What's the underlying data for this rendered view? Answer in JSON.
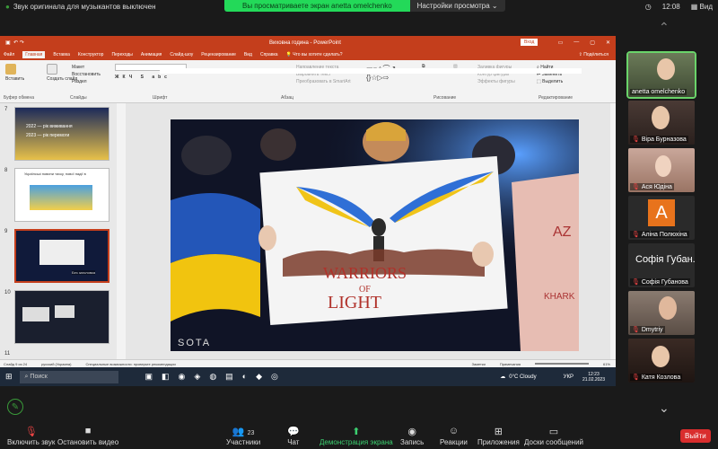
{
  "top": {
    "original_sound_warning": "Звук оригинала для музыкантов выключен",
    "share_banner": "Вы просматриваете экран anetta omelchenko",
    "view_settings": "Настройки просмотра",
    "time": "12:08",
    "view_label": "Вид"
  },
  "powerpoint": {
    "title": "Виховна година - PowerPoint",
    "signin_label": "Вход",
    "tabs": [
      "Файл",
      "Главная",
      "Вставка",
      "Конструктор",
      "Переходы",
      "Анимация",
      "Слайд-шоу",
      "Рецензирование",
      "Вид",
      "Справка"
    ],
    "active_tab": "Главная",
    "search_prompt": "Что вы хотите сделать?",
    "share_label": "Подёлиться",
    "ribbon": {
      "paste": "Вставить",
      "create_slide": "Создать слайд",
      "layout": "Макет",
      "restore": "Восстановить",
      "section": "Раздел",
      "text_direction": "Направление текста",
      "align_text": "Выровнять текст",
      "smartart": "Преобразовать в SmartArt",
      "arrange": "Упорядочить",
      "quick_styles": "Экспресс-стили",
      "shape_fill": "Заливка фигуры",
      "shape_outline": "Контур фигуры",
      "shape_effects": "Эффекты фигуры",
      "find": "Найти",
      "replace": "Заменить",
      "select": "Выделить",
      "groups": [
        "Буфер обмена",
        "Слайды",
        "Шрифт",
        "Абзац",
        "Рисование",
        "Редактирование"
      ]
    },
    "thumbnails": [
      {
        "num": "7",
        "caption_top": "2022 — рік виживання",
        "caption_bottom": "2023 — рік перемоги"
      },
      {
        "num": "8",
        "caption_top": "Українські новини тиску, нової надії в"
      },
      {
        "num": "9",
        "caption_top": "Без заголовка"
      },
      {
        "num": "10",
        "caption_top": ""
      },
      {
        "num": "11",
        "caption_top": ""
      }
    ],
    "slide": {
      "poster_line1": "WARRIORS",
      "poster_line2": "OF",
      "poster_line3": "LIGHT",
      "watermark": "SOTA",
      "side_text": "AZ",
      "side_text2": "KHARK"
    },
    "status": {
      "slide_info": "Слайд 9 из 24",
      "language": "русский (Украина)",
      "accessibility": "Специальные возможности: проверьте рекомендации",
      "notes": "Заметки",
      "comments": "Примечания",
      "zoom": "61%"
    }
  },
  "taskbar": {
    "search_label": "Поиск",
    "weather": "0°C Cloudy",
    "language": "УКР",
    "time": "12:23",
    "date": "21.02.2023"
  },
  "participants": [
    {
      "name": "anetta omelchenko",
      "initial": "",
      "color": "#5a6a4a"
    },
    {
      "name": "Віра Бурназова",
      "initial": "",
      "color": "#4a3a35"
    },
    {
      "name": "Ася Юдіна",
      "initial": "",
      "color": "#c9a79a"
    },
    {
      "name": "Аліна Полюхіна",
      "initial": "A",
      "color": "#e8731c"
    },
    {
      "name": "Софія Губанова",
      "initial": "Софія Губан...",
      "color": "#2a2a2a"
    },
    {
      "name": "Dmytriy",
      "initial": "",
      "color": "#8a7b70"
    },
    {
      "name": "Катя Козлова",
      "initial": "",
      "color": "#3a2a24"
    }
  ],
  "bottom": {
    "unmute": "Включить звук",
    "start_video": "Остановить видео",
    "participants": "Участники",
    "participants_count": "23",
    "chat": "Чат",
    "share_screen": "Демонстрация экрана",
    "record": "Запись",
    "reactions": "Реакции",
    "apps": "Приложения",
    "whiteboards": "Доски сообщений",
    "leave": "Выйти"
  }
}
